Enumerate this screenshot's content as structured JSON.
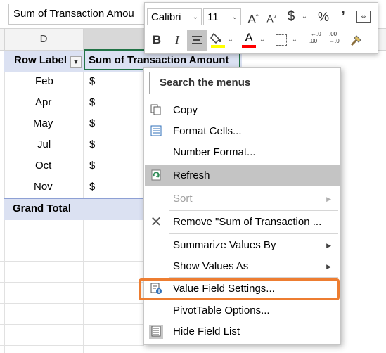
{
  "namebox": {
    "value": "Sum of Transaction Amou"
  },
  "columns": [
    "D"
  ],
  "pivot": {
    "row_label_header": "Row Label",
    "value_header": "Sum of Transaction Amount",
    "rows": [
      {
        "label": "Feb",
        "value": "$"
      },
      {
        "label": "Apr",
        "value": "$"
      },
      {
        "label": "May",
        "value": "$"
      },
      {
        "label": "Jul",
        "value": "$"
      },
      {
        "label": "Oct",
        "value": "$"
      },
      {
        "label": "Nov",
        "value": "$"
      }
    ],
    "grand_total": "Grand Total"
  },
  "mini_toolbar": {
    "font_name": "Calibri",
    "font_size": "11",
    "grow_font": "A",
    "shrink_font": "A",
    "currency": "$",
    "percent": "%",
    "comma": "’",
    "bold": "B",
    "italic": "I",
    "font_color_letter": "A",
    "inc_decimal": ".00",
    "dec_decimal": ".0",
    "font_color": "#ff0000",
    "fill_color": "#ffff00"
  },
  "context_menu": {
    "search": "Search the menus",
    "items": [
      {
        "label": "Copy",
        "icon": "copy-icon"
      },
      {
        "label": "Format Cells...",
        "icon": "format-cells-icon"
      },
      {
        "label": "Number Format...",
        "icon": ""
      },
      {
        "label": "Refresh",
        "icon": "refresh-icon"
      },
      {
        "label": "Sort",
        "icon": ""
      },
      {
        "label": "Remove \"Sum of Transaction ...",
        "icon": "remove-x-icon"
      },
      {
        "label": "Summarize Values By",
        "icon": ""
      },
      {
        "label": "Show Values As",
        "icon": ""
      },
      {
        "label": "Value Field Settings...",
        "icon": "value-field-settings-icon"
      },
      {
        "label": "PivotTable Options...",
        "icon": ""
      },
      {
        "label": "Hide Field List",
        "icon": "field-list-icon"
      }
    ]
  },
  "colors": {
    "accent": "#217346",
    "highlight_outline": "#ed7d31",
    "pivot_header": "#dbe1f2"
  }
}
